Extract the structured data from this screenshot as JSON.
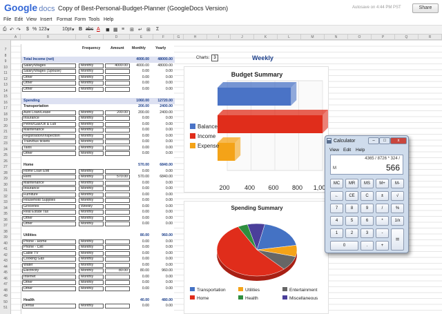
{
  "app": {
    "logo_google": "Google",
    "logo_docs": "docs",
    "doc_title": "Copy of Best-Personal-Budget-Planner (GoogleDocs Version)",
    "autosave": "Autosave on 4:44 PM PST",
    "share": "Share"
  },
  "menu": [
    "File",
    "Edit",
    "View",
    "Insert",
    "Format",
    "Form",
    "Tools",
    "Help"
  ],
  "toolbar": {
    "currency": "$",
    "percent": "%",
    "number_format": "123",
    "font_size": "10pt",
    "bold": "B",
    "strike": "abc",
    "font_color": "A",
    "sigma": "Σ"
  },
  "columns": [
    "A",
    "B",
    "C",
    "D",
    "E",
    "F",
    "G",
    "H",
    "I",
    "J",
    "K",
    "L",
    "M",
    "N",
    "O",
    "P",
    "Q",
    "R",
    "S"
  ],
  "rows": [
    "7",
    "8",
    "9",
    "10",
    "11",
    "12",
    "13",
    "14",
    "15",
    "16",
    "17",
    "18",
    "19",
    "20",
    "21",
    "22",
    "23",
    "24",
    "25",
    "26",
    "27",
    "28",
    "29",
    "30",
    "31",
    "32",
    "33",
    "34",
    "35",
    "36",
    "37",
    "38",
    "39",
    "40",
    "41",
    "42",
    "43",
    "44",
    "45",
    "46",
    "47",
    "48",
    "49",
    "50",
    "51"
  ],
  "headers": {
    "frequency": "Frequency",
    "amount": "Amount",
    "monthly": "Monthly",
    "yearly": "Yearly"
  },
  "income": {
    "title": "Total Income (net)",
    "monthly": "4000.00",
    "yearly": "48000.00",
    "items": [
      {
        "name": "Salary/Wages",
        "freq": "Monthly",
        "amount": "4000.00",
        "monthly": "4000.00",
        "yearly": "48000.00"
      },
      {
        "name": "Salary/Wages (Spouse)",
        "freq": "Monthly",
        "amount": "",
        "monthly": "0.00",
        "yearly": "0.00"
      },
      {
        "name": "Other",
        "freq": "Monthly",
        "amount": "",
        "monthly": "0.00",
        "yearly": "0.00"
      },
      {
        "name": "Other",
        "freq": "Monthly",
        "amount": "",
        "monthly": "0.00",
        "yearly": "0.00"
      },
      {
        "name": "Other",
        "freq": "Monthly",
        "amount": "",
        "monthly": "0.00",
        "yearly": "0.00"
      }
    ]
  },
  "spending": {
    "title": "Spending",
    "monthly": "1060.00",
    "yearly": "12720.00"
  },
  "transportation": {
    "title": "Transportation",
    "monthly": "200.00",
    "yearly": "2400.00",
    "items": [
      {
        "name": "Auto Loan/Lease",
        "freq": "Monthly",
        "amount": "200.00",
        "monthly": "200.00",
        "yearly": "2400.00"
      },
      {
        "name": "Insurance",
        "freq": "Monthly",
        "amount": "",
        "monthly": "0.00",
        "yearly": "0.00"
      },
      {
        "name": "Petrol/Gas/Oil & Lub",
        "freq": "Monthly",
        "amount": "",
        "monthly": "0.00",
        "yearly": "0.00"
      },
      {
        "name": "Maintenance",
        "freq": "Monthly",
        "amount": "",
        "monthly": "0.00",
        "yearly": "0.00"
      },
      {
        "name": "Registration/Inspection",
        "freq": "Monthly",
        "amount": "",
        "monthly": "0.00",
        "yearly": "0.00"
      },
      {
        "name": "Train/Bus tickets",
        "freq": "Monthly",
        "amount": "",
        "monthly": "0.00",
        "yearly": "0.00"
      },
      {
        "name": "Taxis",
        "freq": "Monthly",
        "amount": "",
        "monthly": "0.00",
        "yearly": "0.00"
      },
      {
        "name": "Other",
        "freq": "Monthly",
        "amount": "",
        "monthly": "0.00",
        "yearly": "0.00"
      }
    ]
  },
  "home": {
    "title": "Home",
    "monthly": "570.00",
    "yearly": "6840.00",
    "items": [
      {
        "name": "Home Loan EMI",
        "freq": "Monthly",
        "amount": "",
        "monthly": "0.00",
        "yearly": "0.00"
      },
      {
        "name": "Rent",
        "freq": "Monthly",
        "amount": "570.00",
        "monthly": "570.00",
        "yearly": "6840.00"
      },
      {
        "name": "Maintenance",
        "freq": "Monthly",
        "amount": "",
        "monthly": "0.00",
        "yearly": "0.00"
      },
      {
        "name": "Insurance",
        "freq": "Monthly",
        "amount": "",
        "monthly": "0.00",
        "yearly": "0.00"
      },
      {
        "name": "Furniture",
        "freq": "Monthly",
        "amount": "",
        "monthly": "0.00",
        "yearly": "0.00"
      },
      {
        "name": "Household Supplies",
        "freq": "Monthly",
        "amount": "",
        "monthly": "0.00",
        "yearly": "0.00"
      },
      {
        "name": "Groceries",
        "freq": "Weekly",
        "amount": "",
        "monthly": "0.00",
        "yearly": "0.00"
      },
      {
        "name": "Real Estate Tax",
        "freq": "Monthly",
        "amount": "",
        "monthly": "0.00",
        "yearly": "0.00"
      },
      {
        "name": "Other",
        "freq": "Monthly",
        "amount": "",
        "monthly": "0.00",
        "yearly": "0.00"
      },
      {
        "name": "Other",
        "freq": "Monthly",
        "amount": "",
        "monthly": "0.00",
        "yearly": "0.00"
      }
    ]
  },
  "utilities": {
    "title": "Utilities",
    "monthly": "80.00",
    "yearly": "960.00",
    "items": [
      {
        "name": "Phone - Home",
        "freq": "Monthly",
        "amount": "",
        "monthly": "0.00",
        "yearly": "0.00"
      },
      {
        "name": "Phone - Cell",
        "freq": "Monthly",
        "amount": "",
        "monthly": "0.00",
        "yearly": "0.00"
      },
      {
        "name": "Cable TV",
        "freq": "Monthly",
        "amount": "",
        "monthly": "0.00",
        "yearly": "0.00"
      },
      {
        "name": "Cooking Gas",
        "freq": "Monthly",
        "amount": "",
        "monthly": "0.00",
        "yearly": "0.00"
      },
      {
        "name": "Water",
        "freq": "Monthly",
        "amount": "",
        "monthly": "0.00",
        "yearly": "0.00"
      },
      {
        "name": "Electricity",
        "freq": "Monthly",
        "amount": "80.00",
        "monthly": "80.00",
        "yearly": "960.00"
      },
      {
        "name": "Internet",
        "freq": "Monthly",
        "amount": "",
        "monthly": "0.00",
        "yearly": "0.00"
      },
      {
        "name": "Other",
        "freq": "Monthly",
        "amount": "",
        "monthly": "0.00",
        "yearly": "0.00"
      },
      {
        "name": "Other",
        "freq": "Monthly",
        "amount": "",
        "monthly": "0.00",
        "yearly": "0.00"
      }
    ]
  },
  "health": {
    "title": "Health",
    "monthly": "40.00",
    "yearly": "480.00",
    "items": [
      {
        "name": "Dental",
        "freq": "Monthly",
        "amount": "",
        "monthly": "0.00",
        "yearly": "0.00"
      }
    ]
  },
  "charts_label": "Charts:",
  "charts_value": "3",
  "weekly_label": "Weekly",
  "chart_data": [
    {
      "type": "bar",
      "title": "Budget Summary",
      "orientation": "horizontal",
      "categories": [
        "Expense",
        "Income",
        "Balance"
      ],
      "values": [
        265,
        1000,
        735
      ],
      "colors": [
        "#f4a318",
        "#e02d1b",
        "#4a73c6"
      ],
      "xticks": [
        "200",
        "400",
        "600",
        "800",
        "1,000"
      ],
      "xlim": [
        200,
        1000
      ],
      "legend": "left"
    },
    {
      "type": "pie",
      "title": "Spending Summary",
      "categories": [
        "Transportation",
        "Utilities",
        "Entertainment",
        "Home",
        "Health",
        "Miscellaneous"
      ],
      "values": [
        19,
        7,
        9,
        54,
        4,
        7
      ],
      "colors": [
        "#4472c4",
        "#f4a318",
        "#666666",
        "#e02d1b",
        "#2f8f3f",
        "#4a3f9a"
      ],
      "legend": "bottom"
    }
  ],
  "calculator": {
    "title": "Calculator",
    "menu": [
      "View",
      "Edit",
      "Help"
    ],
    "expression": "4365 / 8726 * 324 /",
    "memory": "M",
    "result": "566",
    "keys": [
      [
        "MC",
        "MR",
        "MS",
        "M+",
        "M-"
      ],
      [
        "←",
        "CE",
        "C",
        "±",
        "√"
      ],
      [
        "7",
        "8",
        "9",
        "/",
        "%"
      ],
      [
        "4",
        "5",
        "6",
        "*",
        "1/x"
      ],
      [
        "1",
        "2",
        "3",
        "-",
        "="
      ],
      [
        "0",
        ".",
        "+"
      ]
    ],
    "window_buttons": [
      "–",
      "□",
      "x"
    ]
  }
}
